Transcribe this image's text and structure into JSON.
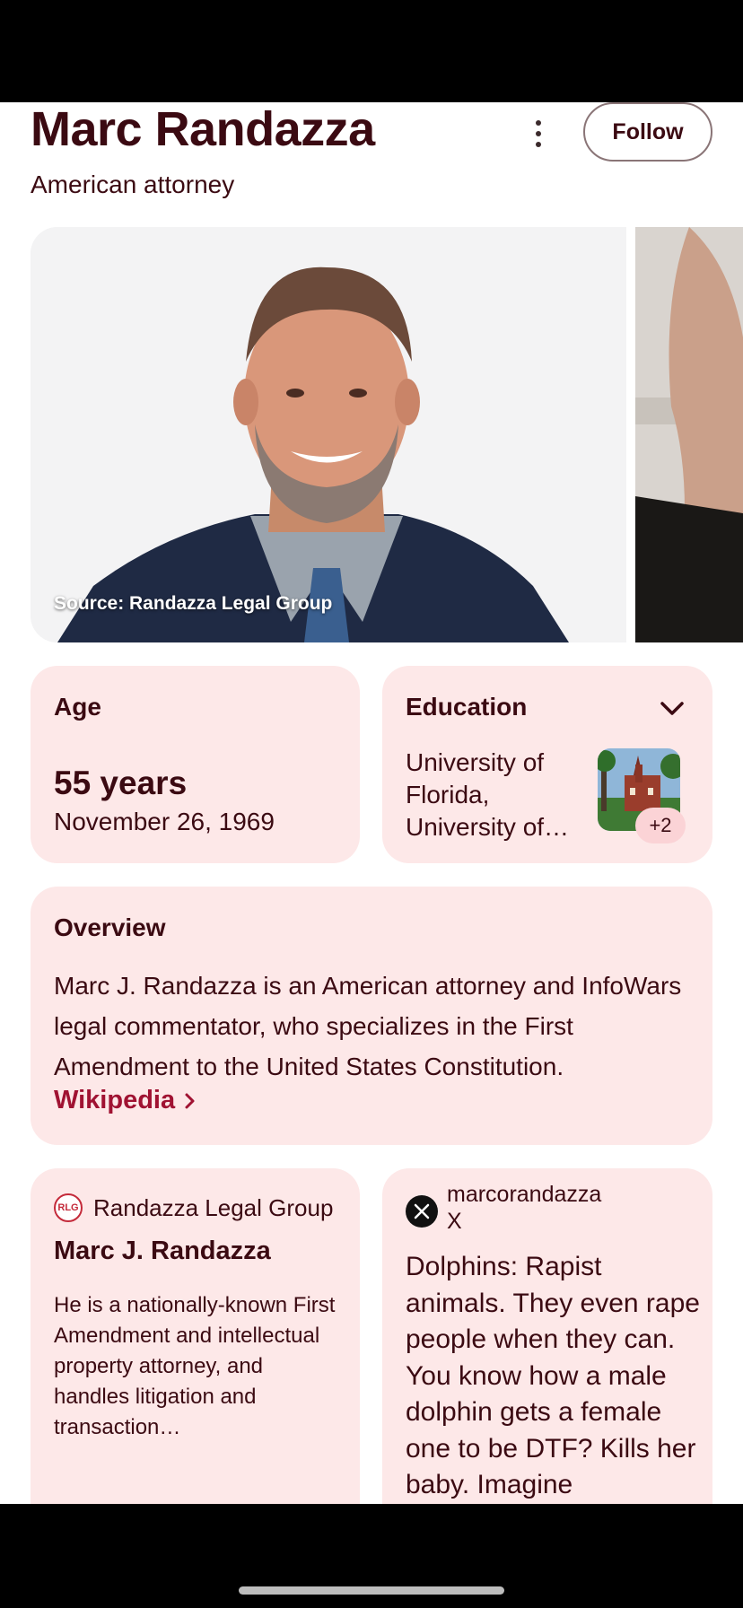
{
  "header": {
    "title": "Marc Randazza",
    "subtitle": "American attorney",
    "follow_label": "Follow"
  },
  "images": {
    "caption": "Source: Randazza Legal Group"
  },
  "age_card": {
    "label": "Age",
    "value": "55 years",
    "date": "November 26, 1969"
  },
  "education_card": {
    "label": "Education",
    "text": "University of Florida, University of…",
    "badge": "+2"
  },
  "overview": {
    "title": "Overview",
    "text": "Marc J. Randazza is an American attorney and InfoWars legal commentator, who specializes in the First Amendment to the United States Constitution.",
    "link_label": "Wikipedia"
  },
  "result_rlg": {
    "logo_text": "RLG",
    "source": "Randazza Legal Group",
    "title": "Marc J. Randazza",
    "description": "He is a nationally-known First Amendment and intellectual property attorney, and handles litigation and transaction…"
  },
  "result_x": {
    "handle": "marcorandazza",
    "site": "X",
    "post": "Dolphins: Rapist animals. They even rape people when they can. You know how a male dolphin gets a female one to be DTF? Kills her baby. Imagine"
  },
  "colors": {
    "title": "#3b0a12",
    "card_bg": "#fde8e8",
    "link": "#a01232"
  }
}
